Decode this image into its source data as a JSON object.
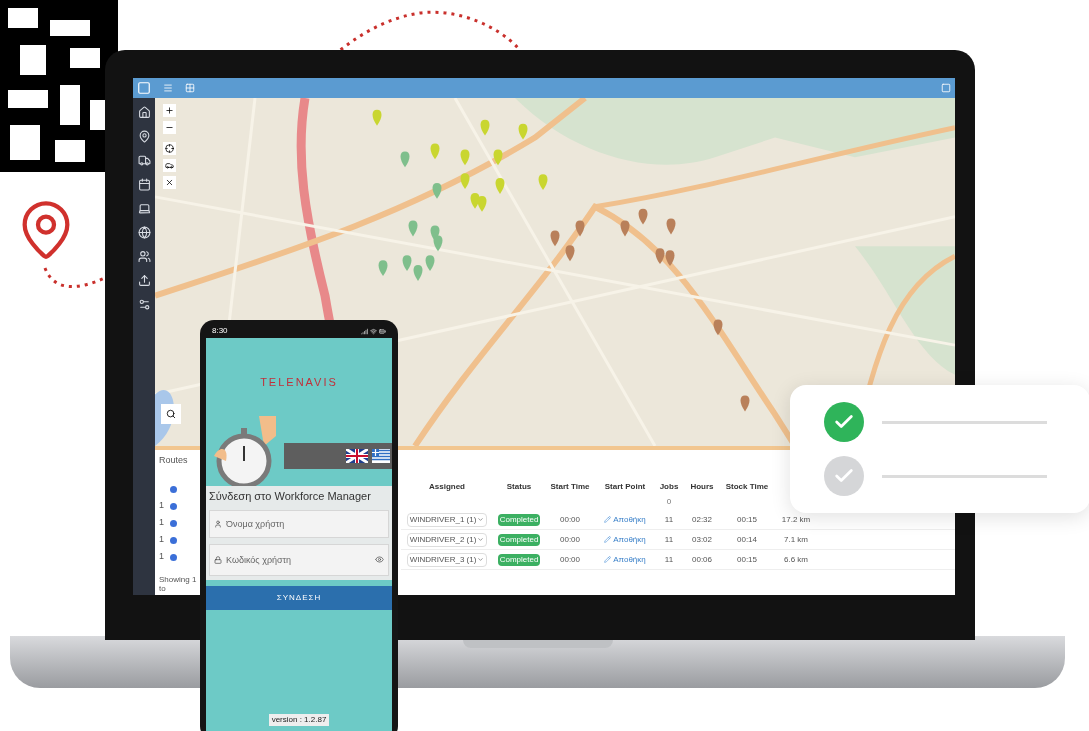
{
  "laptop": {
    "routes_panel": {
      "title": "Routes",
      "rows": [
        {
          "number": ""
        },
        {
          "number": "1"
        },
        {
          "number": "1"
        },
        {
          "number": "1"
        },
        {
          "number": "1"
        }
      ],
      "footer": "Showing 1 to"
    },
    "table": {
      "columns": [
        "Assigned",
        "Status",
        "Start Time",
        "Start Point",
        "Jobs",
        "Hours",
        "Stock Time"
      ],
      "filter_row": {
        "jobs": "0"
      },
      "rows": [
        {
          "assigned": "WINDRIVER_1 (1)",
          "status": "Completed",
          "start_time": "00:00",
          "start_point": "Αποθήκη",
          "jobs": "11",
          "hours": "02:32",
          "stock_time": "00:15",
          "distance": "17.2 km"
        },
        {
          "assigned": "WINDRIVER_2 (1)",
          "status": "Completed",
          "start_time": "00:00",
          "start_point": "Αποθήκη",
          "jobs": "11",
          "hours": "03:02",
          "stock_time": "00:14",
          "distance": "7.1 km"
        },
        {
          "assigned": "WINDRIVER_3 (1)",
          "status": "Completed",
          "start_time": "00:00",
          "start_point": "Αποθήκη",
          "jobs": "11",
          "hours": "00:06",
          "stock_time": "00:15",
          "distance": "6.6 km"
        }
      ]
    }
  },
  "phone": {
    "time": "8:30",
    "logo": "TELENAVIS",
    "title": "Σύνδεση στο Workforce Manager",
    "username": {
      "placeholder": "Όνομα χρήστη"
    },
    "password": {
      "placeholder": "Κωδικός χρήστη"
    },
    "login_button": "ΣΥΝΔΕΣΗ",
    "version": "version : 1.2.87"
  },
  "checklist_card": {
    "items": [
      {
        "checked": true
      },
      {
        "checked": false
      }
    ]
  }
}
